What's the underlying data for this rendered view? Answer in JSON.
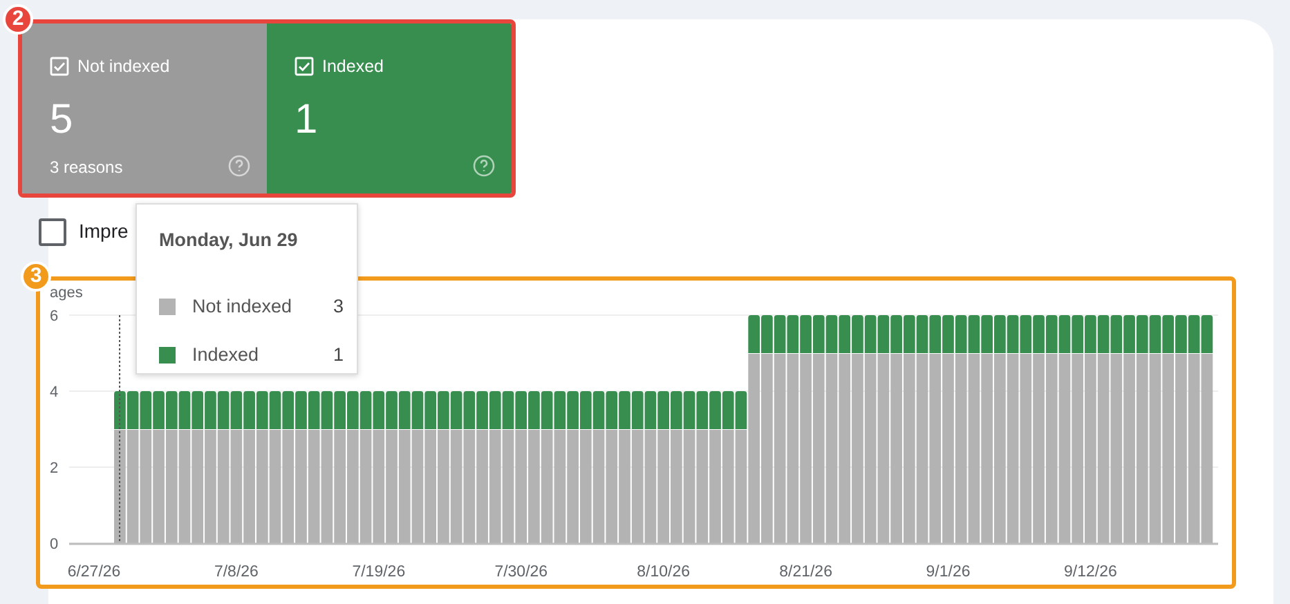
{
  "summary_tiles": [
    {
      "label": "Not indexed",
      "count": "5",
      "subtitle": "3 reasons",
      "checked": true,
      "color": "#9b9b9b"
    },
    {
      "label": "Indexed",
      "count": "1",
      "checked": true,
      "color": "#378e4f"
    }
  ],
  "impressions_toggle": {
    "label": "Impre",
    "checked": false
  },
  "callouts": [
    {
      "number": "2",
      "color": "#e8453c"
    },
    {
      "number": "3",
      "color": "#f29a1b"
    }
  ],
  "tooltip": {
    "title": "Monday, Jun 29",
    "values": [
      "3",
      "1"
    ]
  },
  "chart": {
    "chart_data": {
      "type": "bar",
      "stacked": true,
      "ylabel": "ages",
      "ylim": [
        0,
        6
      ],
      "yticks": [
        0,
        2,
        4,
        6
      ],
      "categories": [
        "6/27/26",
        null,
        null,
        null,
        null,
        null,
        null,
        null,
        null,
        null,
        null,
        "7/8/26",
        null,
        null,
        null,
        null,
        null,
        null,
        null,
        null,
        null,
        null,
        "7/19/26",
        null,
        null,
        null,
        null,
        null,
        null,
        null,
        null,
        null,
        null,
        "7/30/26",
        null,
        null,
        null,
        null,
        null,
        null,
        null,
        null,
        null,
        null,
        "8/10/26",
        null,
        null,
        null,
        null,
        null,
        null,
        null,
        null,
        null,
        null,
        "8/21/26",
        null,
        null,
        null,
        null,
        null,
        null,
        null,
        null,
        null,
        null,
        "9/1/26",
        null,
        null,
        null,
        null,
        null,
        null,
        null,
        null,
        null,
        null,
        "9/12/26",
        null,
        null,
        null,
        null,
        null,
        null,
        null,
        null,
        null
      ],
      "series": [
        {
          "name": "Not indexed",
          "color": "#b3b3b3",
          "values": [
            null,
            null,
            3,
            3,
            3,
            3,
            3,
            3,
            3,
            3,
            3,
            3,
            3,
            3,
            3,
            3,
            3,
            3,
            3,
            3,
            3,
            3,
            3,
            3,
            3,
            3,
            3,
            3,
            3,
            3,
            3,
            3,
            3,
            3,
            3,
            3,
            3,
            3,
            3,
            3,
            3,
            3,
            3,
            3,
            3,
            3,
            3,
            3,
            3,
            3,
            3,
            5,
            5,
            5,
            5,
            5,
            5,
            5,
            5,
            5,
            5,
            5,
            5,
            5,
            5,
            5,
            5,
            5,
            5,
            5,
            5,
            5,
            5,
            5,
            5,
            5,
            5,
            5,
            5,
            5,
            5,
            5,
            5,
            5,
            5,
            5,
            5
          ]
        },
        {
          "name": "Indexed",
          "color": "#378e4f",
          "values": [
            null,
            null,
            1,
            1,
            1,
            1,
            1,
            1,
            1,
            1,
            1,
            1,
            1,
            1,
            1,
            1,
            1,
            1,
            1,
            1,
            1,
            1,
            1,
            1,
            1,
            1,
            1,
            1,
            1,
            1,
            1,
            1,
            1,
            1,
            1,
            1,
            1,
            1,
            1,
            1,
            1,
            1,
            1,
            1,
            1,
            1,
            1,
            1,
            1,
            1,
            1,
            1,
            1,
            1,
            1,
            1,
            1,
            1,
            1,
            1,
            1,
            1,
            1,
            1,
            1,
            1,
            1,
            1,
            1,
            1,
            1,
            1,
            1,
            1,
            1,
            1,
            1,
            1,
            1,
            1,
            1,
            1,
            1,
            1,
            1,
            1,
            1
          ]
        }
      ]
    }
  }
}
